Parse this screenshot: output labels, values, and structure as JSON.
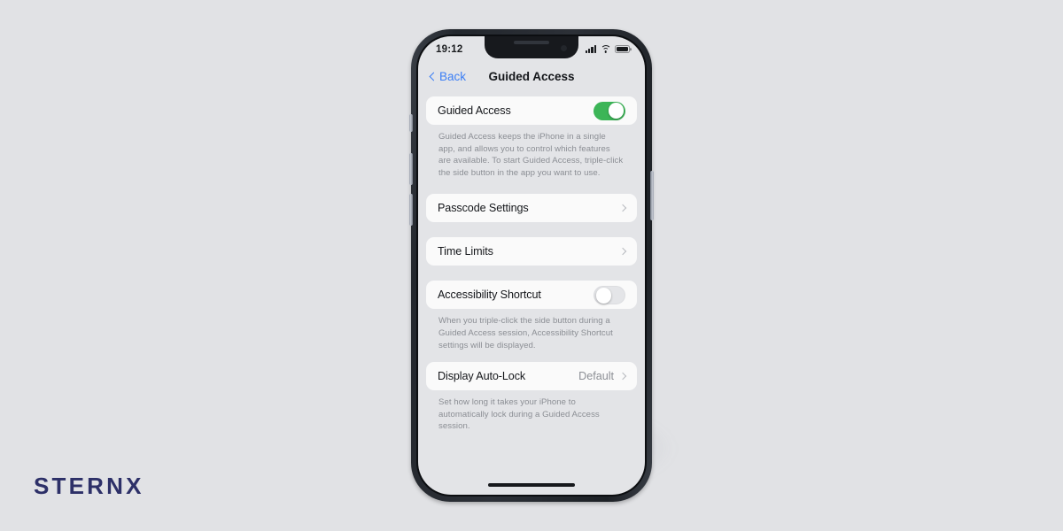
{
  "brand": {
    "name": "STERNX"
  },
  "device": {
    "status_bar": {
      "time": "19:12",
      "icons": [
        "cellular-signal-icon",
        "wifi-icon",
        "battery-icon"
      ]
    },
    "nav": {
      "back_label": "Back",
      "title": "Guided Access"
    },
    "home_indicator": true
  },
  "settings": {
    "sections": [
      {
        "id": "guided-access",
        "rows": [
          {
            "label": "Guided Access",
            "type": "toggle",
            "value": "on"
          }
        ],
        "footnote": "Guided Access keeps the iPhone in a single app, and allows you to control which features are available. To start Guided Access, triple-click the side button in the app you want to use."
      },
      {
        "id": "passcode-settings",
        "rows": [
          {
            "label": "Passcode Settings",
            "type": "disclosure",
            "value": ""
          }
        ],
        "footnote": ""
      },
      {
        "id": "time-limits",
        "rows": [
          {
            "label": "Time Limits",
            "type": "disclosure",
            "value": ""
          }
        ],
        "footnote": ""
      },
      {
        "id": "accessibility-shortcut",
        "rows": [
          {
            "label": "Accessibility Shortcut",
            "type": "toggle",
            "value": "off"
          }
        ],
        "footnote": "When you triple-click the side button during a Guided Access session, Accessibility Shortcut settings will be displayed."
      },
      {
        "id": "display-auto-lock",
        "rows": [
          {
            "label": "Display Auto-Lock",
            "type": "disclosure",
            "value": "Default"
          }
        ],
        "footnote": "Set how long it takes your iPhone to automatically lock during a Guided Access session."
      }
    ]
  },
  "colors": {
    "page_background": "#e1e2e5",
    "brand_navy": "#2d3068",
    "ios_blue": "#3b7ef5",
    "toggle_on_green": "#3cb557",
    "toggle_off_gray": "#e4e5e8",
    "card_background": "#fafafa",
    "screen_background": "#e3e4e7",
    "footnote_gray": "#8b8e94"
  }
}
